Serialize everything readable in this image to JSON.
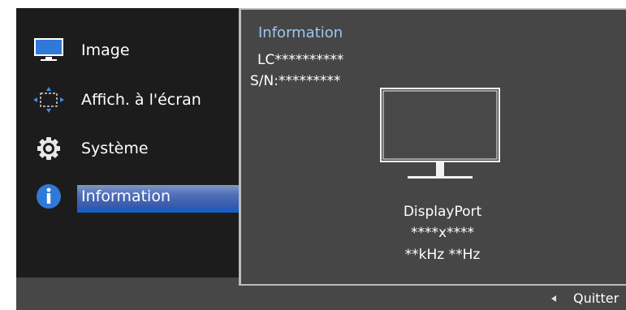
{
  "menu": {
    "items": [
      {
        "label": "Image",
        "icon": "picture-icon"
      },
      {
        "label": "Affich. à l'écran",
        "icon": "onscreen-display-icon"
      },
      {
        "label": "Système",
        "icon": "gear-icon"
      },
      {
        "label": "Information",
        "icon": "info-icon",
        "selected": true
      }
    ]
  },
  "info": {
    "title": "Information",
    "model": "LC**********",
    "serial": "S/N:*********",
    "input": "DisplayPort",
    "resolution": "****x****",
    "frequency": "**kHz **Hz"
  },
  "footer": {
    "quit_label": "Quitter"
  },
  "colors": {
    "menu_background": "#1c1c1c",
    "content_background": "#464646",
    "title_accent": "#9ec6ef",
    "selection": "#2b4fa8"
  }
}
